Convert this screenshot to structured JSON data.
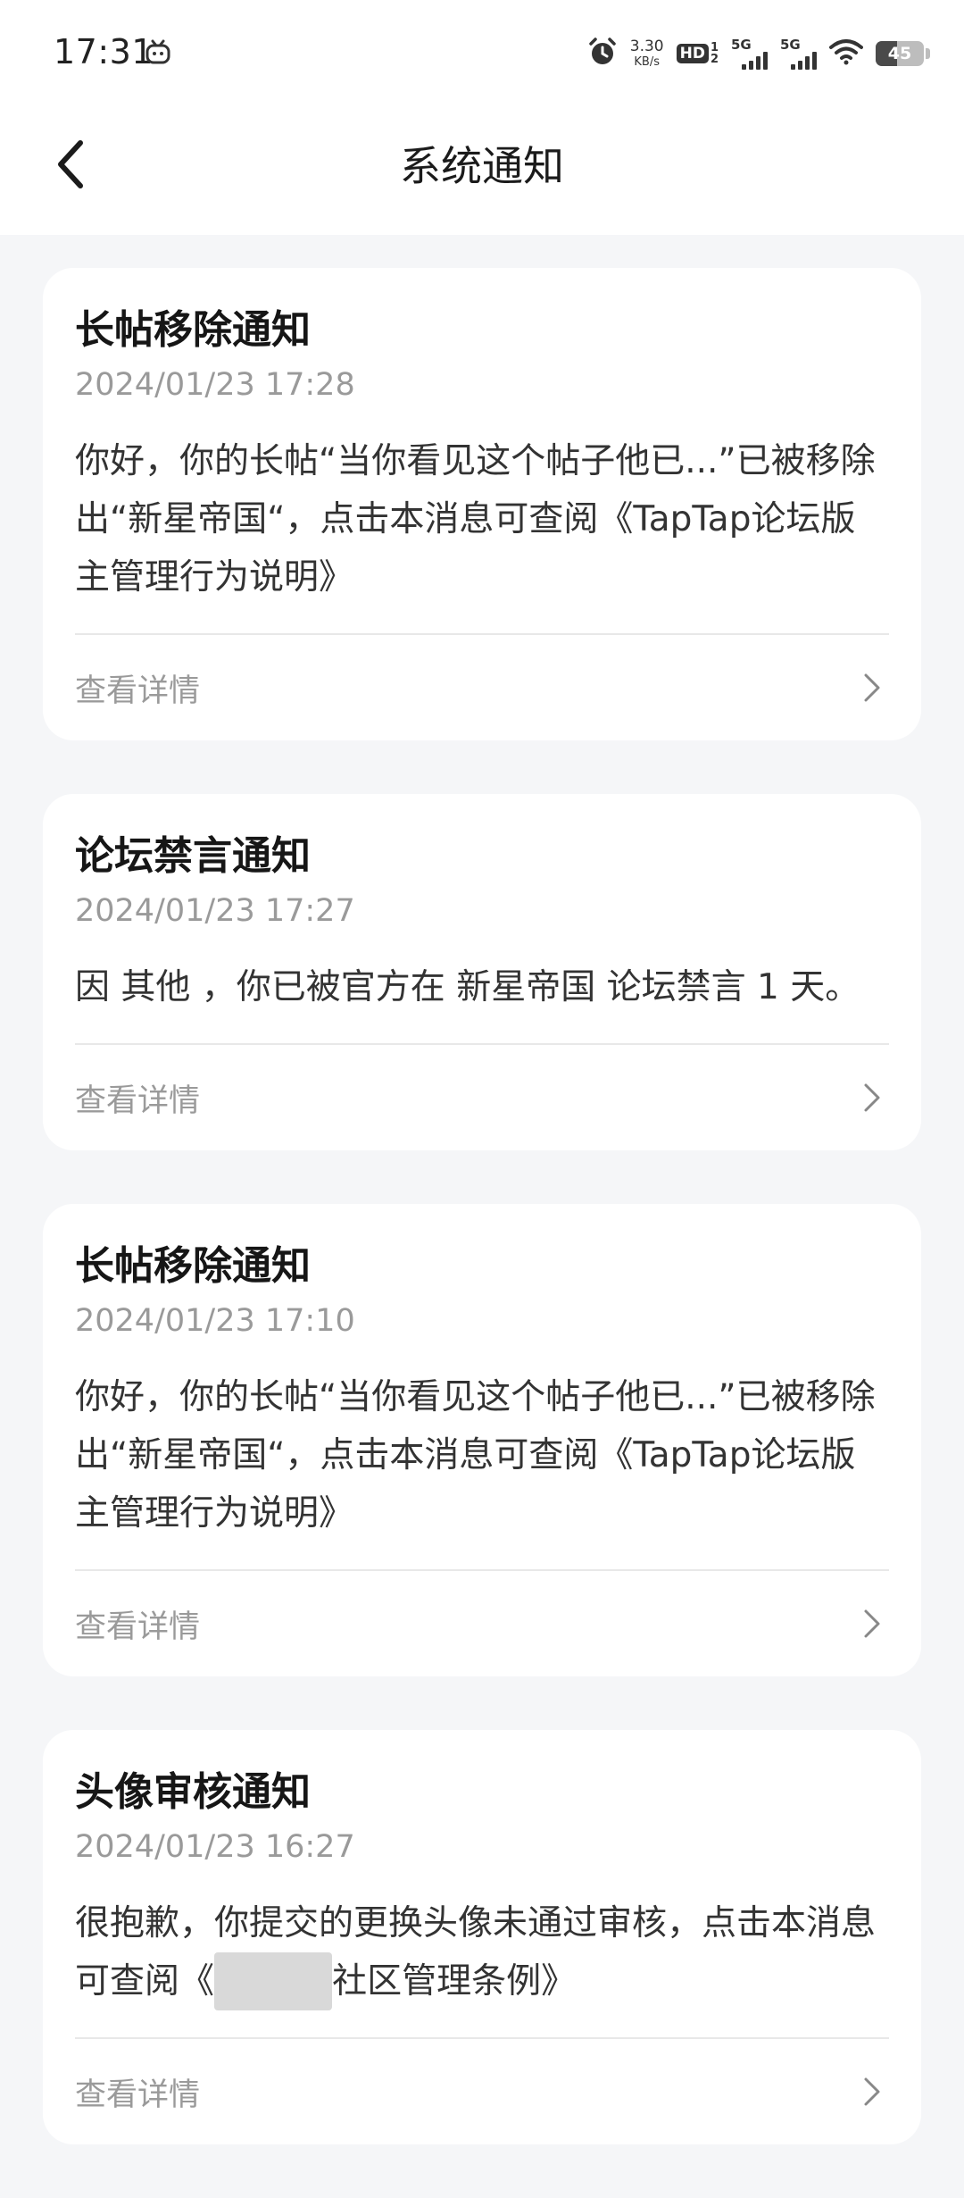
{
  "status_bar": {
    "time": "17:31",
    "net_speed_value": "3.30",
    "net_speed_unit": "KB/s",
    "hd_label": "HD",
    "hd_sup": "1",
    "hd_sub": "2",
    "sim1_label": "5G",
    "sim2_label": "5G",
    "battery": "45",
    "battery_level": 0.45
  },
  "header": {
    "title": "系统通知"
  },
  "notifications": [
    {
      "title": "长帖移除通知",
      "time": "2024/01/23 17:28",
      "body": "你好，你的长帖“当你看见这个帖子他已...”已被移除出“新星帝国“，点击本消息可查阅《TapTap论坛版主管理行为说明》",
      "detail_label": "查看详情"
    },
    {
      "title": "论坛禁言通知",
      "time": "2024/01/23 17:27",
      "body": "因 其他 ，你已被官方在 新星帝国 论坛禁言 1 天。",
      "detail_label": "查看详情"
    },
    {
      "title": "长帖移除通知",
      "time": "2024/01/23 17:10",
      "body": "你好，你的长帖“当你看见这个帖子他已...”已被移除出“新星帝国“，点击本消息可查阅《TapTap论坛版主管理行为说明》",
      "detail_label": "查看详情"
    },
    {
      "title": "头像审核通知",
      "time": "2024/01/23 16:27",
      "body": "很抱歉，你提交的更换头像未通过审核，点击本消息可查阅《",
      "body_tail": "社区管理条例》",
      "detail_label": "查看详情"
    }
  ]
}
